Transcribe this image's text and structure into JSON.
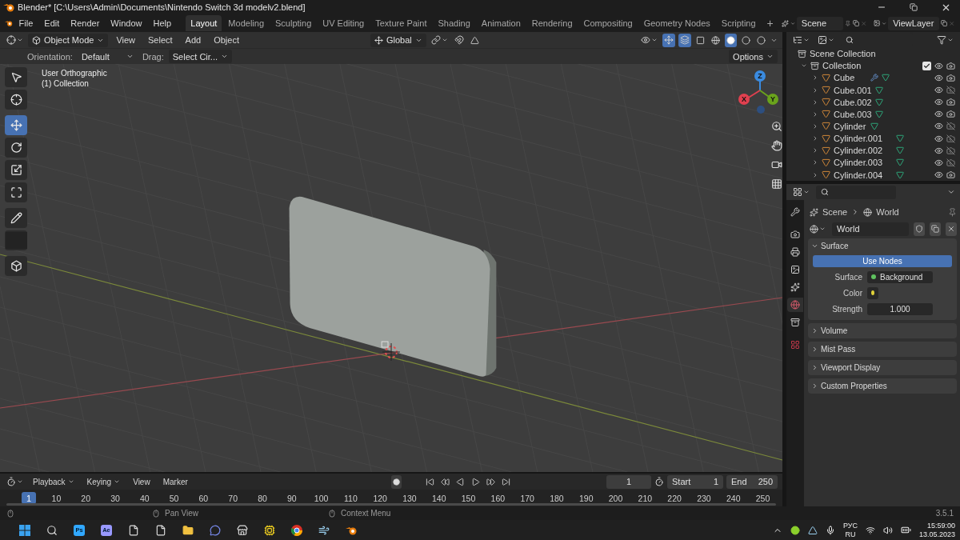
{
  "window": {
    "title": "Blender* [C:\\Users\\Admin\\Documents\\Nintendo Switch 3d modelv2.blend]"
  },
  "menu": [
    "File",
    "Edit",
    "Render",
    "Window",
    "Help"
  ],
  "workspaces": [
    {
      "label": "Layout",
      "selected": true
    },
    {
      "label": "Modeling",
      "selected": false
    },
    {
      "label": "Sculpting",
      "selected": false
    },
    {
      "label": "UV Editing",
      "selected": false
    },
    {
      "label": "Texture Paint",
      "selected": false
    },
    {
      "label": "Shading",
      "selected": false
    },
    {
      "label": "Animation",
      "selected": false
    },
    {
      "label": "Rendering",
      "selected": false
    },
    {
      "label": "Compositing",
      "selected": false
    },
    {
      "label": "Geometry Nodes",
      "selected": false
    },
    {
      "label": "Scripting",
      "selected": false
    }
  ],
  "add_workspace": "+",
  "scene": "Scene",
  "view_layer": "ViewLayer",
  "viewport": {
    "mode": "Object Mode",
    "menus": [
      "View",
      "Select",
      "Add",
      "Object"
    ],
    "transform_orientation": "Global",
    "toggles": [
      {
        "kind": "gizmo",
        "on": true
      },
      {
        "kind": "overlay",
        "on": true
      }
    ],
    "shading": [
      {
        "kind": "wireframe",
        "selected": false
      },
      {
        "kind": "solid",
        "selected": true
      },
      {
        "kind": "material",
        "selected": false
      },
      {
        "kind": "rendered",
        "selected": false
      }
    ],
    "tool_settings": {
      "orientation_label": "Orientation:",
      "orientation": "Default",
      "drag_label": "Drag:",
      "drag": "Select Cir...",
      "options": "Options"
    },
    "overlay_lines": [
      "User Orthographic",
      "(1) Collection"
    ],
    "gizmo_axes": [
      "X",
      "Y",
      "Z"
    ],
    "tools": [
      {
        "kind": "select",
        "selected": false
      },
      {
        "kind": "cursor",
        "selected": false
      },
      {
        "kind": "move",
        "selected": true
      },
      {
        "kind": "rotate",
        "selected": false
      },
      {
        "kind": "scale",
        "selected": false
      },
      {
        "kind": "transform",
        "selected": false
      },
      {
        "kind": "annotate",
        "selected": false
      },
      {
        "kind": "measure",
        "selected": false
      },
      {
        "kind": "add-cube",
        "selected": false
      }
    ]
  },
  "outliner": {
    "root": "Scene Collection",
    "collection": {
      "name": "Collection",
      "expanded": true,
      "checked": true
    },
    "objects": [
      {
        "name": "Cube",
        "has_modifier": true,
        "renderable": true
      },
      {
        "name": "Cube.001",
        "has_modifier": false,
        "renderable": false
      },
      {
        "name": "Cube.002",
        "has_modifier": false,
        "renderable": true
      },
      {
        "name": "Cube.003",
        "has_modifier": false,
        "renderable": true
      },
      {
        "name": "Cylinder",
        "has_modifier": false,
        "renderable": false
      },
      {
        "name": "Cylinder.001",
        "has_modifier": false,
        "renderable": false
      },
      {
        "name": "Cylinder.002",
        "has_modifier": false,
        "renderable": false
      },
      {
        "name": "Cylinder.003",
        "has_modifier": false,
        "renderable": false
      },
      {
        "name": "Cylinder.004",
        "has_modifier": false,
        "renderable": true
      }
    ]
  },
  "properties": {
    "tabs": [
      {
        "kind": "tool",
        "selected": false
      },
      {
        "kind": "render",
        "selected": false
      },
      {
        "kind": "output",
        "selected": false
      },
      {
        "kind": "view-layer",
        "selected": false
      },
      {
        "kind": "scene",
        "selected": false
      },
      {
        "kind": "world",
        "selected": true
      },
      {
        "kind": "collection",
        "selected": false
      },
      {
        "kind": "texture",
        "selected": false
      }
    ],
    "breadcrumb": [
      "Scene",
      "World"
    ],
    "datablock": "World",
    "use_nodes": "Use Nodes",
    "surface_label": "Surface",
    "surface": "Background",
    "color_label": "Color",
    "strength_label": "Strength",
    "strength": "1.000",
    "panels": [
      {
        "title": "Surface",
        "expanded": true
      },
      {
        "title": "Volume",
        "expanded": false
      },
      {
        "title": "Mist Pass",
        "expanded": false
      },
      {
        "title": "Viewport Display",
        "expanded": false
      },
      {
        "title": "Custom Properties",
        "expanded": false
      }
    ]
  },
  "timeline": {
    "menus": [
      {
        "label": "Playback",
        "dropdown": true
      },
      {
        "label": "Keying",
        "dropdown": true
      },
      {
        "label": "View",
        "dropdown": false
      },
      {
        "label": "Marker",
        "dropdown": false
      }
    ],
    "current_frame": "1",
    "start_label": "Start",
    "start": "1",
    "end_label": "End",
    "end": "250",
    "ruler_current": "1",
    "ruler": [
      "10",
      "20",
      "30",
      "40",
      "50",
      "60",
      "70",
      "80",
      "90",
      "100",
      "110",
      "120",
      "130",
      "140",
      "150",
      "160",
      "170",
      "180",
      "190",
      "200",
      "210",
      "220",
      "230",
      "240",
      "250"
    ]
  },
  "status_bar": {
    "hints": [
      "Pan View",
      "Context Menu"
    ],
    "version": "3.5.1"
  },
  "taskbar": {
    "apps": [
      {
        "kind": "start"
      },
      {
        "kind": "search"
      },
      {
        "kind": "badge",
        "label": "Ps",
        "color": "#31a8ff"
      },
      {
        "kind": "badge",
        "label": "Ae",
        "color": "#9999ff"
      },
      {
        "kind": "file"
      },
      {
        "kind": "file"
      },
      {
        "kind": "folder"
      },
      {
        "kind": "chat"
      },
      {
        "kind": "store"
      },
      {
        "kind": "app"
      },
      {
        "kind": "browser"
      },
      {
        "kind": "tool"
      },
      {
        "kind": "blender"
      }
    ],
    "language": [
      "РУС",
      "RU"
    ],
    "time": "15:59:00",
    "date": "13.05.2023"
  }
}
